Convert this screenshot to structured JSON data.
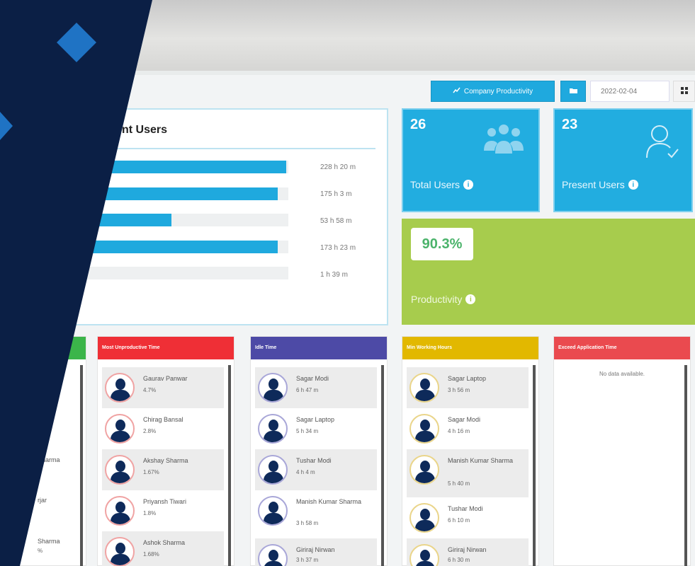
{
  "toolbar": {
    "company_productivity_label": "Company Productivity",
    "date_value": "2022-02-04"
  },
  "top_users": {
    "title": "nt Users",
    "items": [
      {
        "value": "228 h 20 m",
        "fill": 0.99
      },
      {
        "value": "175 h 3 m",
        "fill": 0.95
      },
      {
        "value": "53 h 58 m",
        "fill": 0.46
      },
      {
        "value": "173 h 23 m",
        "fill": 0.95
      },
      {
        "value": "1 h 39 m",
        "fill": 0.02
      }
    ]
  },
  "stats": {
    "total_users": {
      "value": "26",
      "label": "Total Users"
    },
    "present_users": {
      "value": "23",
      "label": "Present Users"
    },
    "productivity": {
      "value": "90.3%",
      "label": "Productivity"
    }
  },
  "cards": {
    "unproductive": {
      "title": "Most Unproductive Time",
      "color": "#ef2f36",
      "items": [
        {
          "name": "Gaurav Panwar",
          "value": "4.7%"
        },
        {
          "name": "Chirag Bansal",
          "value": "2.8%"
        },
        {
          "name": "Akshay Sharma",
          "value": "1.67%"
        },
        {
          "name": "Priyansh Tiwari",
          "value": "1.8%"
        },
        {
          "name": "Ashok Sharma",
          "value": "1.68%"
        }
      ]
    },
    "idle": {
      "title": "Idle Time",
      "color": "#4d4aa6",
      "items": [
        {
          "name": "Sagar Modi",
          "value": "6 h 47 m"
        },
        {
          "name": "Sagar Laptop",
          "value": "5 h 34 m"
        },
        {
          "name": "Tushar Modi",
          "value": "4 h 4 m"
        },
        {
          "name": "Manish Kumar Sharma",
          "value": "3 h 58 m"
        },
        {
          "name": "Giriraj Nirwan",
          "value": "3 h 37 m"
        }
      ]
    },
    "working": {
      "title": "Min Working Hours",
      "color": "#e2b800",
      "items": [
        {
          "name": "Sagar Laptop",
          "value": "3 h 56 m"
        },
        {
          "name": "Sagar Modi",
          "value": "4 h 16 m"
        },
        {
          "name": "Manish Kumar Sharma",
          "value": "5 h 40 m"
        },
        {
          "name": "Tushar Modi",
          "value": "6 h 10 m"
        },
        {
          "name": "Giriraj Nirwan",
          "value": "6 h 30 m"
        }
      ]
    },
    "exceed": {
      "title": "Exceed Application Time",
      "color": "#ea4a4f",
      "empty_text": "No data available."
    },
    "left_partial": {
      "color": "#3bb54a",
      "items": [
        {
          "name": "Sharma",
          "value": "%"
        },
        {
          "name": "rjar",
          "value": ""
        },
        {
          "name": "Sharma",
          "value": "%"
        }
      ]
    }
  },
  "colors": {
    "navy_overlay": "#0b1f45",
    "accent_blue": "#22ade0",
    "productivity_green": "#a7cc4d"
  }
}
